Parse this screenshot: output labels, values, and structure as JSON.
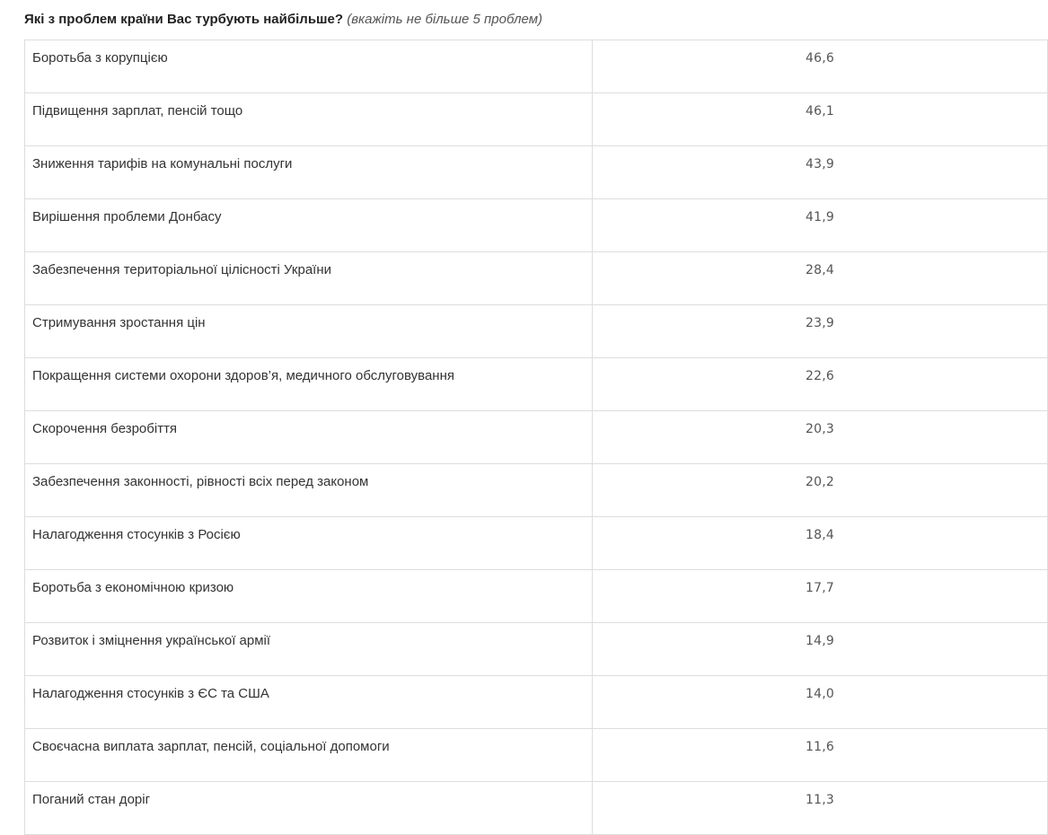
{
  "heading": {
    "question": "Які з проблем країни Вас турбують найбільше?",
    "hint": "(вкажіть не більше 5 проблем)"
  },
  "rows": [
    {
      "label": "Боротьба з корупцією",
      "value": "46,6"
    },
    {
      "label": "Підвищення зарплат, пенсій тощо",
      "value": "46,1"
    },
    {
      "label": "Зниження тарифів на комунальні послуги",
      "value": "43,9"
    },
    {
      "label": "Вирішення проблеми Донбасу",
      "value": "41,9"
    },
    {
      "label": "Забезпечення територіальної цілісності України",
      "value": "28,4"
    },
    {
      "label": "Стримування зростання цін",
      "value": "23,9"
    },
    {
      "label": "Покращення системи охорони здоров’я, медичного обслуговування",
      "value": "22,6"
    },
    {
      "label": "Скорочення безробіття",
      "value": "20,3"
    },
    {
      "label": "Забезпечення законності, рівності всіх перед законом",
      "value": "20,2"
    },
    {
      "label": "Налагодження стосунків з Росією",
      "value": "18,4"
    },
    {
      "label": "Боротьба з економічною кризою",
      "value": "17,7"
    },
    {
      "label": "Розвиток і зміцнення української армії",
      "value": "14,9"
    },
    {
      "label": "Налагодження стосунків з ЄС та США",
      "value": "14,0"
    },
    {
      "label": "Своєчасна виплата зарплат, пенсій, соціальної допомоги",
      "value": "11,6"
    },
    {
      "label": "Поганий стан доріг",
      "value": "11,3"
    }
  ]
}
